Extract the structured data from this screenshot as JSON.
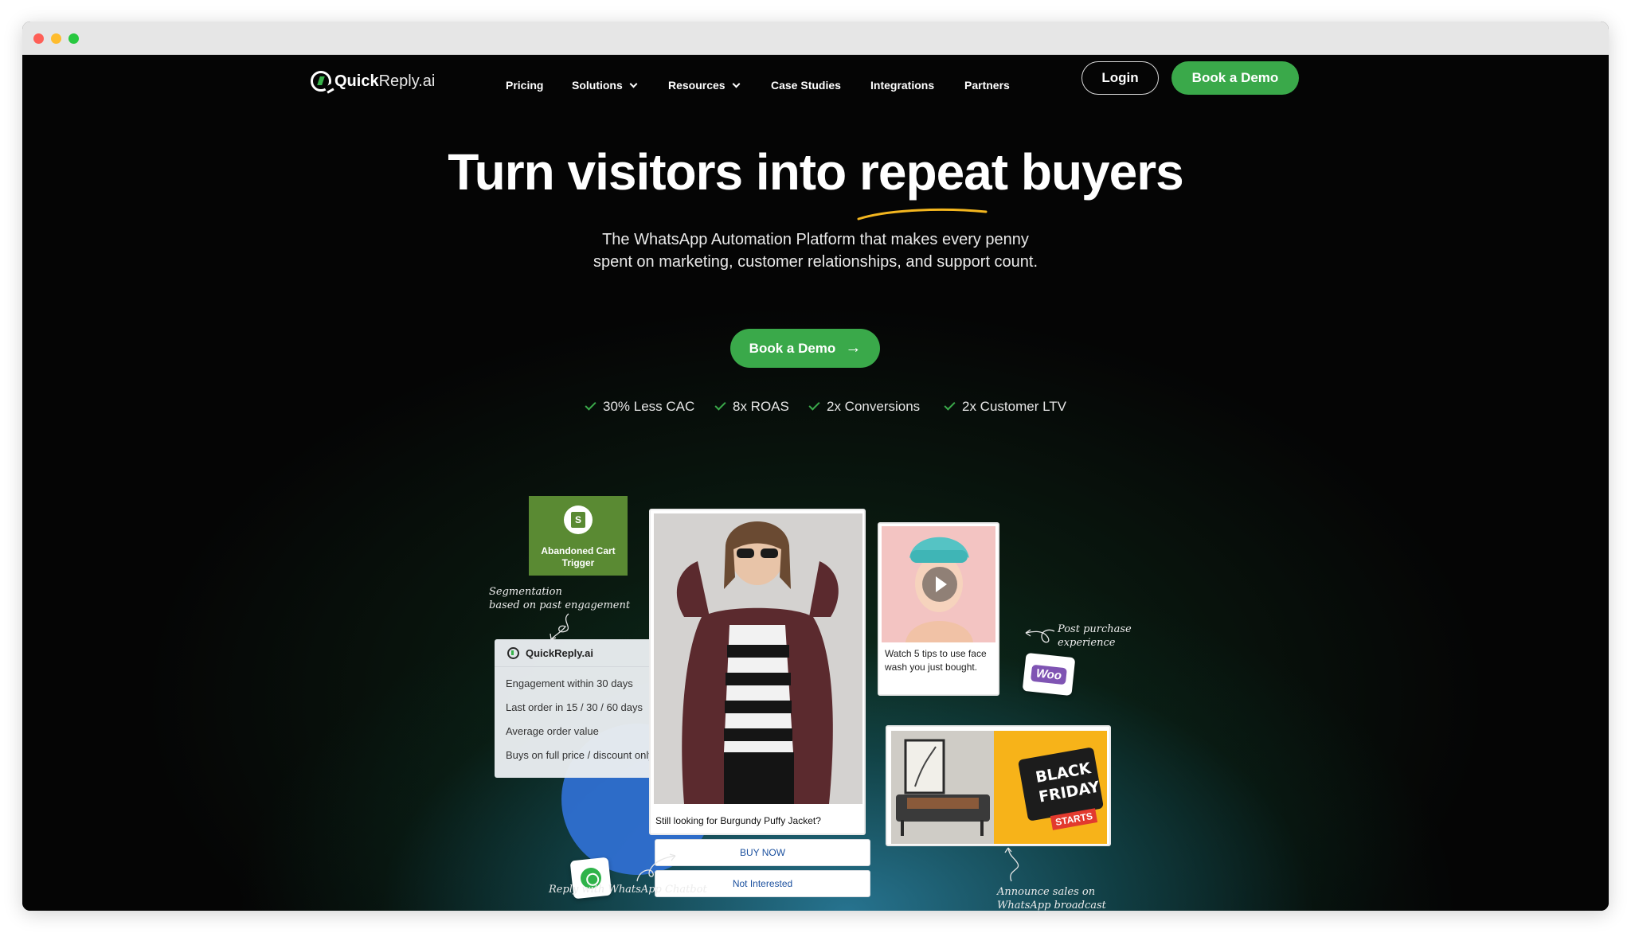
{
  "brand": {
    "name_bold": "Quick",
    "name_light": "Reply.ai"
  },
  "nav": {
    "items": [
      {
        "label": "Pricing",
        "has_dropdown": false
      },
      {
        "label": "Solutions",
        "has_dropdown": true
      },
      {
        "label": "Resources",
        "has_dropdown": true
      },
      {
        "label": "Case Studies",
        "has_dropdown": false
      },
      {
        "label": "Integrations",
        "has_dropdown": false
      },
      {
        "label": "Partners",
        "has_dropdown": false
      }
    ],
    "login_label": "Login",
    "demo_label": "Book a Demo"
  },
  "hero": {
    "headline": "Turn visitors into repeat buyers",
    "subtext_line1": "The WhatsApp Automation Platform that makes every penny",
    "subtext_line2": "spent on marketing, customer relationships, and support count.",
    "cta_label": "Book a Demo",
    "stats": [
      "30% Less CAC",
      "8x ROAS",
      "2x Conversions",
      "2x Customer LTV"
    ]
  },
  "illustration": {
    "trigger_card": "Abandoned Cart Trigger",
    "annot_segmentation_1": "Segmentation",
    "annot_segmentation_2": "based on past engagement",
    "segment_card": {
      "title": "QuickReply.ai",
      "rows": [
        "Engagement within 30 days",
        "Last order in 15 / 30 / 60 days",
        "Average order value",
        "Buys on full price / discount only"
      ]
    },
    "product_caption": "Still looking for Burgundy Puffy Jacket?",
    "buy_now": "BUY NOW",
    "not_interested": "Not Interested",
    "video_caption": "Watch 5 tips to use face wash you just bought.",
    "annot_post_1": "Post purchase",
    "annot_post_2": "experience",
    "woo_label": "Woo",
    "bf_line1": "BLACK",
    "bf_line2": "FRIDAY",
    "bf_starts": "STARTS",
    "annot_announce_1": "Announce sales on",
    "annot_announce_2": "WhatsApp broadcast",
    "annot_reply": "Reply with WhatsApp Chatbot"
  },
  "colors": {
    "accent": "#3aa94a",
    "background": "#050505",
    "link_blue": "#1a4f9e"
  }
}
